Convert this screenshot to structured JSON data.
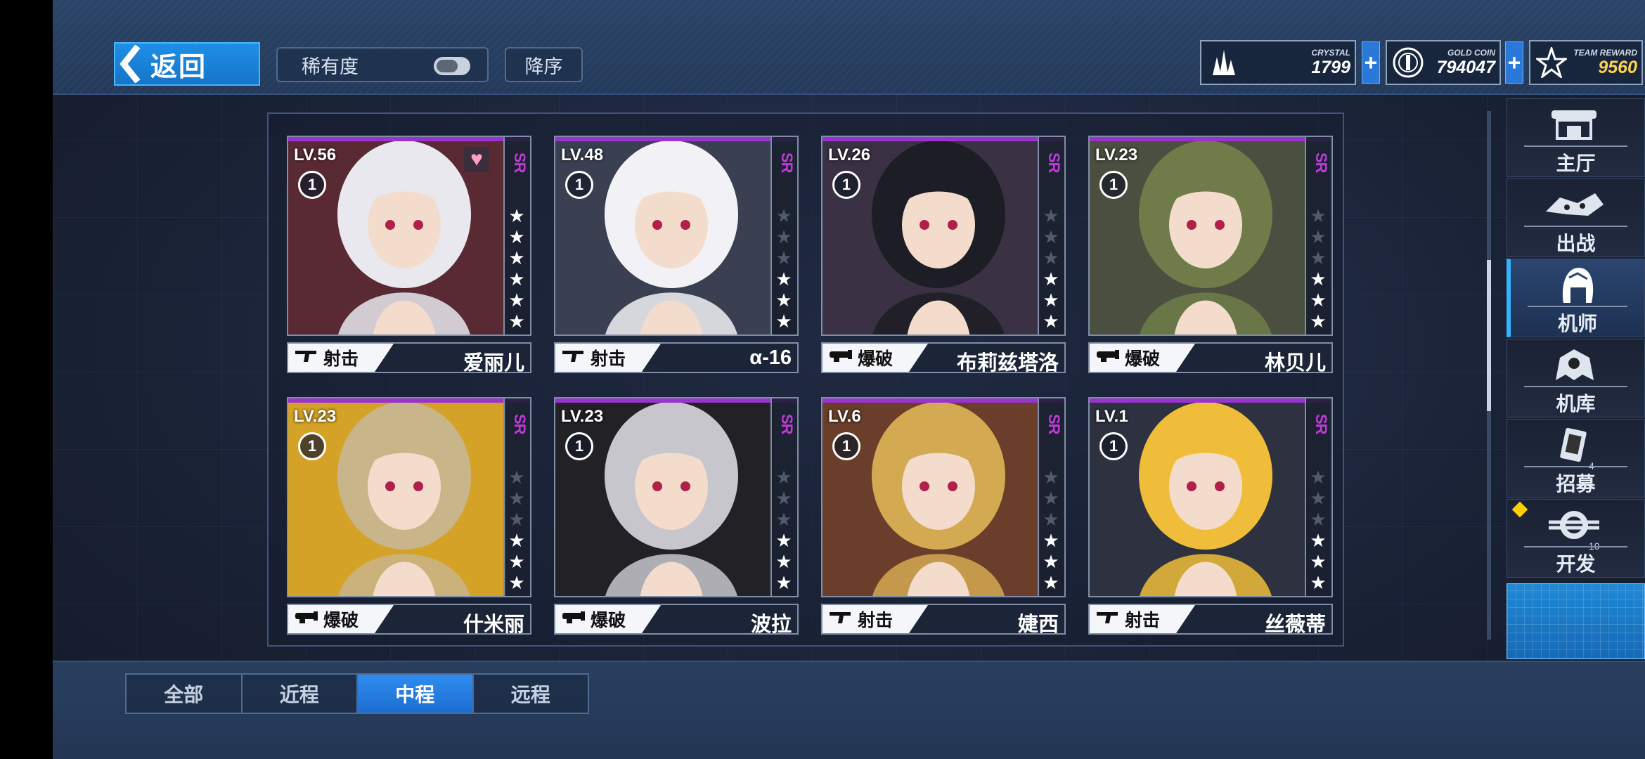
{
  "header": {
    "back_label": "返回",
    "rarity_label": "稀有度",
    "sort_label": "降序"
  },
  "resources": [
    {
      "caption": "CRYSTAL",
      "value": "1799",
      "icon": "crystal-icon"
    },
    {
      "caption": "GOLD COIN",
      "value": "794047",
      "icon": "gold-coin-icon"
    },
    {
      "caption": "TEAM REWARD",
      "value": "9560",
      "icon": "team-reward-icon"
    }
  ],
  "plus_label": "+",
  "pilots": [
    {
      "level": "LV.56",
      "rank": "1",
      "rarity": "SR",
      "stars": 6,
      "type": "射击",
      "name": "爱丽儿",
      "favorite": true
    },
    {
      "level": "LV.48",
      "rank": "1",
      "rarity": "SR",
      "stars": 3,
      "type": "射击",
      "name": "α-16",
      "favorite": false
    },
    {
      "level": "LV.26",
      "rank": "1",
      "rarity": "SR",
      "stars": 3,
      "type": "爆破",
      "name": "布莉兹塔洛",
      "favorite": false
    },
    {
      "level": "LV.23",
      "rank": "1",
      "rarity": "SR",
      "stars": 3,
      "type": "爆破",
      "name": "林贝儿",
      "favorite": false
    },
    {
      "level": "LV.23",
      "rank": "1",
      "rarity": "SR",
      "stars": 3,
      "type": "爆破",
      "name": "什米丽",
      "favorite": false
    },
    {
      "level": "LV.23",
      "rank": "1",
      "rarity": "SR",
      "stars": 3,
      "type": "爆破",
      "name": "波拉",
      "favorite": false
    },
    {
      "level": "LV.6",
      "rank": "1",
      "rarity": "SR",
      "stars": 3,
      "type": "射击",
      "name": "婕西",
      "favorite": false
    },
    {
      "level": "LV.1",
      "rank": "1",
      "rarity": "SR",
      "stars": 3,
      "type": "射击",
      "name": "丝薇蒂",
      "favorite": false
    }
  ],
  "star_total": 6,
  "nav": [
    {
      "label": "主厅",
      "icon": "hall-icon",
      "active": false
    },
    {
      "label": "出战",
      "icon": "sortie-icon",
      "active": false
    },
    {
      "label": "机师",
      "icon": "pilot-icon",
      "active": true
    },
    {
      "label": "机库",
      "icon": "hangar-icon",
      "active": false
    },
    {
      "label": "招募",
      "icon": "recruit-icon",
      "active": false,
      "count": "4"
    },
    {
      "label": "开发",
      "icon": "develop-icon",
      "active": false,
      "count": "10",
      "alert": true
    }
  ],
  "tabs": [
    {
      "label": "全部",
      "active": false
    },
    {
      "label": "近程",
      "active": false
    },
    {
      "label": "中程",
      "active": true
    },
    {
      "label": "远程",
      "active": false
    }
  ],
  "colors": {
    "accent": "#1f8fe6",
    "rarity_sr": "#c03ad8",
    "card_topline": "#9a32d0",
    "team_reward": "#ffd34d"
  }
}
